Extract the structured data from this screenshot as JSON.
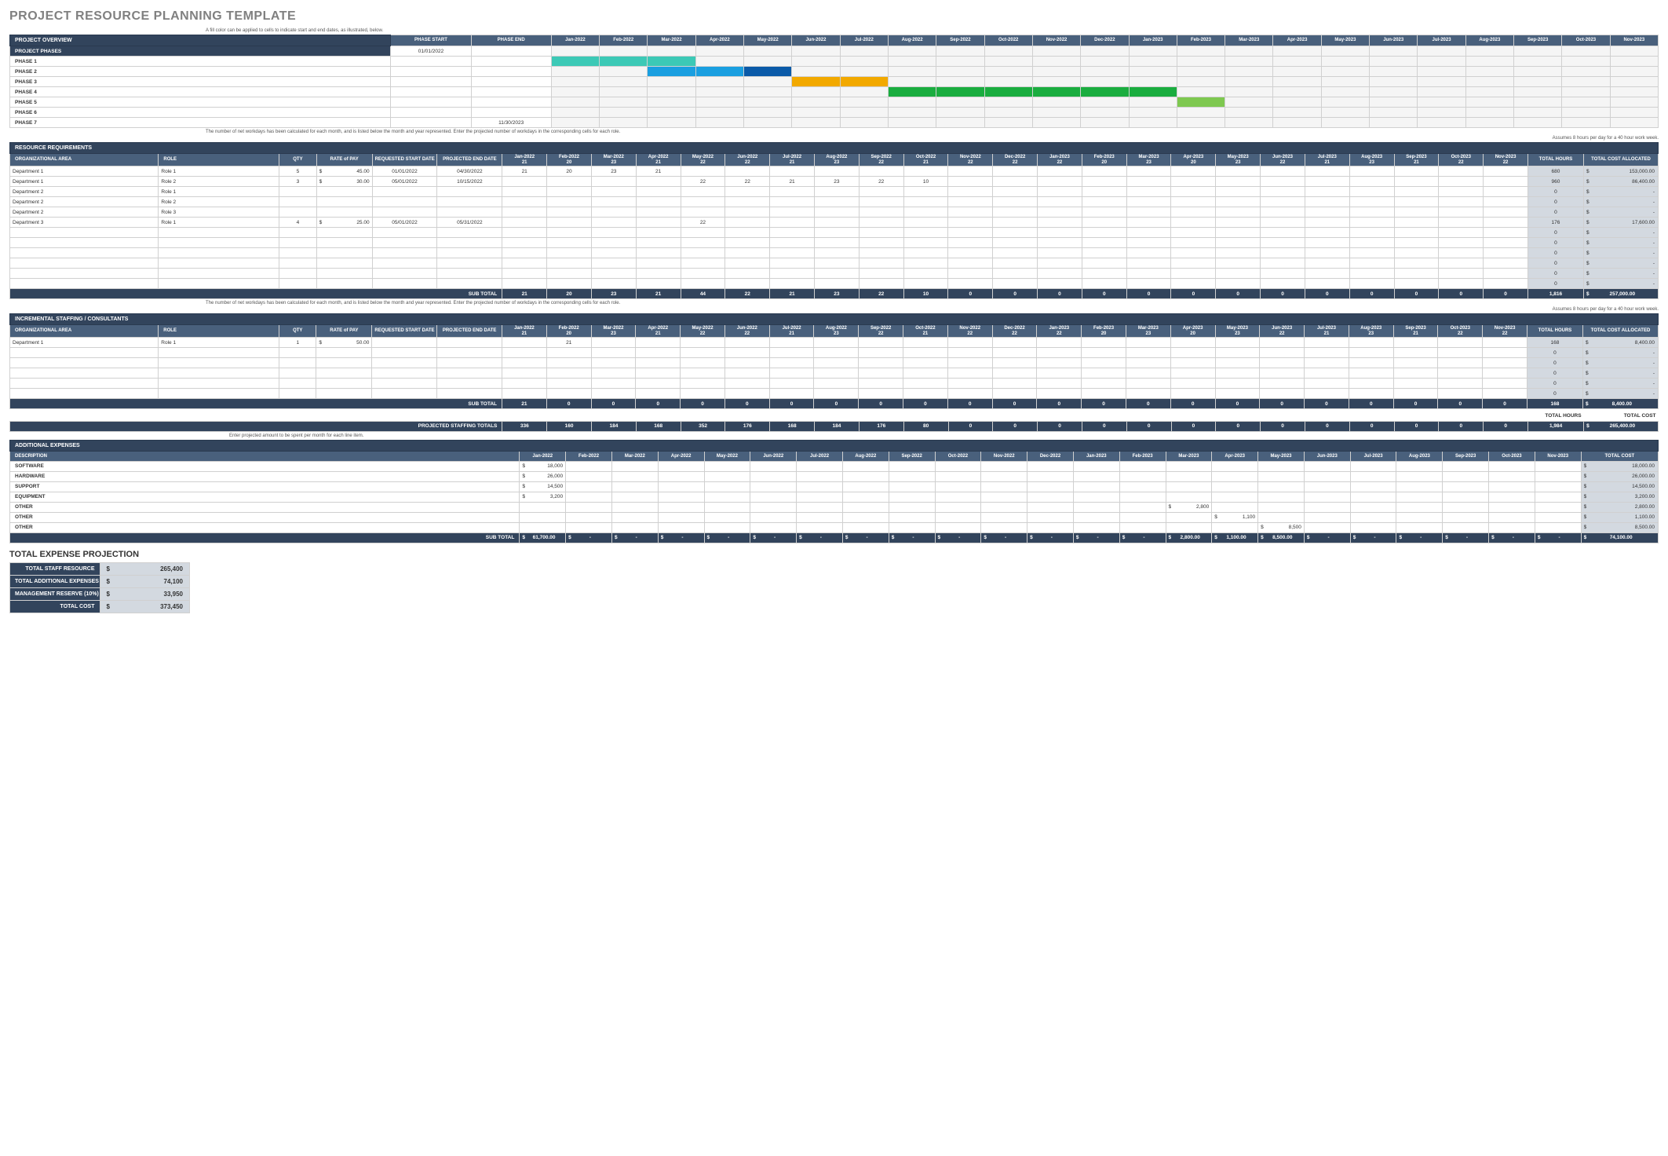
{
  "title": "PROJECT RESOURCE PLANNING TEMPLATE",
  "notes": {
    "gantt_hint": "A fill color can be applied to cells to indicate start and end dates, as illustrated, below.",
    "workdays_hint": "The number of net workdays has been calculated for each month, and is listed below the month and year represented. Enter the projected number of workdays in the corresponding cells for each role.",
    "hours_assumption": "Assumes 8 hours per day for a 40 hour work week.",
    "expense_hint": "Enter projected amount to be spent per month for each line item."
  },
  "months": [
    "Jan-2022",
    "Feb-2022",
    "Mar-2022",
    "Apr-2022",
    "May-2022",
    "Jun-2022",
    "Jul-2022",
    "Aug-2022",
    "Sep-2022",
    "Oct-2022",
    "Nov-2022",
    "Dec-2022",
    "Jan-2023",
    "Feb-2023",
    "Mar-2023",
    "Apr-2023",
    "May-2023",
    "Jun-2023",
    "Jul-2023",
    "Aug-2023",
    "Sep-2023",
    "Oct-2023",
    "Nov-2023"
  ],
  "workdays": [
    "21",
    "20",
    "23",
    "21",
    "22",
    "22",
    "21",
    "23",
    "22",
    "21",
    "22",
    "22",
    "22",
    "20",
    "23",
    "20",
    "23",
    "22",
    "21",
    "23",
    "21",
    "22",
    "22"
  ],
  "overview": {
    "section": "PROJECT OVERVIEW",
    "cols": [
      "PHASE START",
      "PHASE END"
    ],
    "rows": [
      {
        "label": "PROJECT PHASES",
        "start": "01/01/2022",
        "end": "",
        "highlight": true,
        "bars": []
      },
      {
        "label": "PHASE 1",
        "start": "",
        "end": "",
        "bars": [
          {
            "c": "g-teal",
            "s": 0,
            "e": 3
          }
        ]
      },
      {
        "label": "PHASE 2",
        "start": "",
        "end": "",
        "bars": [
          {
            "c": "g-blue",
            "s": 2,
            "e": 4
          },
          {
            "c": "g-dblue",
            "s": 4,
            "e": 5
          }
        ]
      },
      {
        "label": "PHASE 3",
        "start": "",
        "end": "",
        "bars": [
          {
            "c": "g-orange",
            "s": 5,
            "e": 7
          }
        ]
      },
      {
        "label": "PHASE 4",
        "start": "",
        "end": "",
        "bars": [
          {
            "c": "g-green",
            "s": 7,
            "e": 13
          }
        ]
      },
      {
        "label": "PHASE 5",
        "start": "",
        "end": "",
        "bars": [
          {
            "c": "g-lgreen",
            "s": 13,
            "e": 14
          }
        ]
      },
      {
        "label": "PHASE 6",
        "start": "",
        "end": "",
        "bars": []
      },
      {
        "label": "PHASE 7",
        "start": "",
        "end": "11/30/2023",
        "bars": []
      }
    ]
  },
  "resources": {
    "section": "RESOURCE REQUIREMENTS",
    "headers": [
      "ORGANIZATIONAL AREA",
      "ROLE",
      "QTY",
      "RATE of PAY",
      "REQUESTED START DATE",
      "PROJECTED END DATE"
    ],
    "totals_headers": [
      "TOTAL HOURS",
      "TOTAL COST ALLOCATED"
    ],
    "rows": [
      {
        "area": "Department 1",
        "role": "Role 1",
        "qty": "5",
        "rate": "45.00",
        "start": "01/01/2022",
        "end": "04/30/2022",
        "months": [
          "21",
          "20",
          "23",
          "21",
          "",
          "",
          "",
          "",
          "",
          "",
          "",
          "",
          "",
          "",
          "",
          "",
          "",
          "",
          "",
          "",
          "",
          "",
          ""
        ],
        "hours": "680",
        "cost": "153,000.00"
      },
      {
        "area": "Department 1",
        "role": "Role 2",
        "qty": "3",
        "rate": "30.00",
        "start": "05/01/2022",
        "end": "10/15/2022",
        "months": [
          "",
          "",
          "",
          "",
          "22",
          "22",
          "21",
          "23",
          "22",
          "10",
          "",
          "",
          "",
          "",
          "",
          "",
          "",
          "",
          "",
          "",
          "",
          "",
          ""
        ],
        "hours": "960",
        "cost": "86,400.00"
      },
      {
        "area": "Department 2",
        "role": "Role 1",
        "qty": "",
        "rate": "",
        "start": "",
        "end": "",
        "months": [
          "",
          "",
          "",
          "",
          "",
          "",
          "",
          "",
          "",
          "",
          "",
          "",
          "",
          "",
          "",
          "",
          "",
          "",
          "",
          "",
          "",
          "",
          ""
        ],
        "hours": "0",
        "cost": "-"
      },
      {
        "area": "Department 2",
        "role": "Role 2",
        "qty": "",
        "rate": "",
        "start": "",
        "end": "",
        "months": [
          "",
          "",
          "",
          "",
          "",
          "",
          "",
          "",
          "",
          "",
          "",
          "",
          "",
          "",
          "",
          "",
          "",
          "",
          "",
          "",
          "",
          "",
          ""
        ],
        "hours": "0",
        "cost": "-"
      },
      {
        "area": "Department 2",
        "role": "Role 3",
        "qty": "",
        "rate": "",
        "start": "",
        "end": "",
        "months": [
          "",
          "",
          "",
          "",
          "",
          "",
          "",
          "",
          "",
          "",
          "",
          "",
          "",
          "",
          "",
          "",
          "",
          "",
          "",
          "",
          "",
          "",
          ""
        ],
        "hours": "0",
        "cost": "-"
      },
      {
        "area": "Department 3",
        "role": "Role 1",
        "qty": "4",
        "rate": "25.00",
        "start": "05/01/2022",
        "end": "05/31/2022",
        "months": [
          "",
          "",
          "",
          "",
          "22",
          "",
          "",
          "",
          "",
          "",
          "",
          "",
          "",
          "",
          "",
          "",
          "",
          "",
          "",
          "",
          "",
          "",
          ""
        ],
        "hours": "176",
        "cost": "17,600.00"
      },
      {
        "area": "",
        "role": "",
        "qty": "",
        "rate": "",
        "start": "",
        "end": "",
        "months": [
          "",
          "",
          "",
          "",
          "",
          "",
          "",
          "",
          "",
          "",
          "",
          "",
          "",
          "",
          "",
          "",
          "",
          "",
          "",
          "",
          "",
          "",
          ""
        ],
        "hours": "0",
        "cost": "-"
      },
      {
        "area": "",
        "role": "",
        "qty": "",
        "rate": "",
        "start": "",
        "end": "",
        "months": [
          "",
          "",
          "",
          "",
          "",
          "",
          "",
          "",
          "",
          "",
          "",
          "",
          "",
          "",
          "",
          "",
          "",
          "",
          "",
          "",
          "",
          "",
          ""
        ],
        "hours": "0",
        "cost": "-"
      },
      {
        "area": "",
        "role": "",
        "qty": "",
        "rate": "",
        "start": "",
        "end": "",
        "months": [
          "",
          "",
          "",
          "",
          "",
          "",
          "",
          "",
          "",
          "",
          "",
          "",
          "",
          "",
          "",
          "",
          "",
          "",
          "",
          "",
          "",
          "",
          ""
        ],
        "hours": "0",
        "cost": "-"
      },
      {
        "area": "",
        "role": "",
        "qty": "",
        "rate": "",
        "start": "",
        "end": "",
        "months": [
          "",
          "",
          "",
          "",
          "",
          "",
          "",
          "",
          "",
          "",
          "",
          "",
          "",
          "",
          "",
          "",
          "",
          "",
          "",
          "",
          "",
          "",
          ""
        ],
        "hours": "0",
        "cost": "-"
      },
      {
        "area": "",
        "role": "",
        "qty": "",
        "rate": "",
        "start": "",
        "end": "",
        "months": [
          "",
          "",
          "",
          "",
          "",
          "",
          "",
          "",
          "",
          "",
          "",
          "",
          "",
          "",
          "",
          "",
          "",
          "",
          "",
          "",
          "",
          "",
          ""
        ],
        "hours": "0",
        "cost": "-"
      },
      {
        "area": "",
        "role": "",
        "qty": "",
        "rate": "",
        "start": "",
        "end": "",
        "months": [
          "",
          "",
          "",
          "",
          "",
          "",
          "",
          "",
          "",
          "",
          "",
          "",
          "",
          "",
          "",
          "",
          "",
          "",
          "",
          "",
          "",
          "",
          ""
        ],
        "hours": "0",
        "cost": "-"
      }
    ],
    "subtotal": {
      "label": "SUB TOTAL",
      "months": [
        "21",
        "20",
        "23",
        "21",
        "44",
        "22",
        "21",
        "23",
        "22",
        "10",
        "0",
        "0",
        "0",
        "0",
        "0",
        "0",
        "0",
        "0",
        "0",
        "0",
        "0",
        "0",
        "0"
      ],
      "hours": "1,816",
      "cost": "257,000.00"
    }
  },
  "consultants": {
    "section": "INCREMENTAL STAFFING / CONSULTANTS",
    "rows": [
      {
        "area": "Department 1",
        "role": "Role 1",
        "qty": "1",
        "rate": "50.00",
        "start": "",
        "end": "",
        "months": [
          "",
          "21",
          "",
          "",
          "",
          "",
          "",
          "",
          "",
          "",
          "",
          "",
          "",
          "",
          "",
          "",
          "",
          "",
          "",
          "",
          "",
          "",
          ""
        ],
        "hours": "168",
        "cost": "8,400.00"
      },
      {
        "area": "",
        "role": "",
        "qty": "",
        "rate": "",
        "start": "",
        "end": "",
        "months": [
          "",
          "",
          "",
          "",
          "",
          "",
          "",
          "",
          "",
          "",
          "",
          "",
          "",
          "",
          "",
          "",
          "",
          "",
          "",
          "",
          "",
          "",
          ""
        ],
        "hours": "0",
        "cost": "-"
      },
      {
        "area": "",
        "role": "",
        "qty": "",
        "rate": "",
        "start": "",
        "end": "",
        "months": [
          "",
          "",
          "",
          "",
          "",
          "",
          "",
          "",
          "",
          "",
          "",
          "",
          "",
          "",
          "",
          "",
          "",
          "",
          "",
          "",
          "",
          "",
          ""
        ],
        "hours": "0",
        "cost": "-"
      },
      {
        "area": "",
        "role": "",
        "qty": "",
        "rate": "",
        "start": "",
        "end": "",
        "months": [
          "",
          "",
          "",
          "",
          "",
          "",
          "",
          "",
          "",
          "",
          "",
          "",
          "",
          "",
          "",
          "",
          "",
          "",
          "",
          "",
          "",
          "",
          ""
        ],
        "hours": "0",
        "cost": "-"
      },
      {
        "area": "",
        "role": "",
        "qty": "",
        "rate": "",
        "start": "",
        "end": "",
        "months": [
          "",
          "",
          "",
          "",
          "",
          "",
          "",
          "",
          "",
          "",
          "",
          "",
          "",
          "",
          "",
          "",
          "",
          "",
          "",
          "",
          "",
          "",
          ""
        ],
        "hours": "0",
        "cost": "-"
      },
      {
        "area": "",
        "role": "",
        "qty": "",
        "rate": "",
        "start": "",
        "end": "",
        "months": [
          "",
          "",
          "",
          "",
          "",
          "",
          "",
          "",
          "",
          "",
          "",
          "",
          "",
          "",
          "",
          "",
          "",
          "",
          "",
          "",
          "",
          "",
          ""
        ],
        "hours": "0",
        "cost": "-"
      }
    ],
    "subtotal": {
      "label": "SUB TOTAL",
      "months": [
        "21",
        "0",
        "0",
        "0",
        "0",
        "0",
        "0",
        "0",
        "0",
        "0",
        "0",
        "0",
        "0",
        "0",
        "0",
        "0",
        "0",
        "0",
        "0",
        "0",
        "0",
        "0",
        "0"
      ],
      "hours": "168",
      "cost": "8,400.00"
    }
  },
  "staffing_totals": {
    "labels": [
      "TOTAL HOURS",
      "TOTAL COST"
    ],
    "label": "PROJECTED STAFFING TOTALS",
    "months": [
      "336",
      "160",
      "184",
      "168",
      "352",
      "176",
      "168",
      "184",
      "176",
      "80",
      "0",
      "0",
      "0",
      "0",
      "0",
      "0",
      "0",
      "0",
      "0",
      "0",
      "0",
      "0",
      "0"
    ],
    "hours": "1,984",
    "cost": "265,400.00"
  },
  "expenses": {
    "section": "ADDITIONAL EXPENSES",
    "desc_hdr": "DESCRIPTION",
    "total_hdr": "TOTAL COST",
    "rows": [
      {
        "desc": "SOFTWARE",
        "months": [
          "18,000",
          "",
          "",
          "",
          "",
          "",
          "",
          "",
          "",
          "",
          "",
          "",
          "",
          "",
          "",
          "",
          "",
          "",
          "",
          "",
          "",
          "",
          ""
        ],
        "total": "18,000.00"
      },
      {
        "desc": "HARDWARE",
        "months": [
          "26,000",
          "",
          "",
          "",
          "",
          "",
          "",
          "",
          "",
          "",
          "",
          "",
          "",
          "",
          "",
          "",
          "",
          "",
          "",
          "",
          "",
          "",
          ""
        ],
        "total": "26,000.00"
      },
      {
        "desc": "SUPPORT",
        "months": [
          "14,500",
          "",
          "",
          "",
          "",
          "",
          "",
          "",
          "",
          "",
          "",
          "",
          "",
          "",
          "",
          "",
          "",
          "",
          "",
          "",
          "",
          "",
          ""
        ],
        "total": "14,500.00"
      },
      {
        "desc": "EQUIPMENT",
        "months": [
          "3,200",
          "",
          "",
          "",
          "",
          "",
          "",
          "",
          "",
          "",
          "",
          "",
          "",
          "",
          "",
          "",
          "",
          "",
          "",
          "",
          "",
          "",
          ""
        ],
        "total": "3,200.00"
      },
      {
        "desc": "OTHER",
        "months": [
          "",
          "",
          "",
          "",
          "",
          "",
          "",
          "",
          "",
          "",
          "",
          "",
          "",
          "",
          "2,800",
          "",
          "",
          "",
          "",
          "",
          "",
          "",
          ""
        ],
        "total": "2,800.00"
      },
      {
        "desc": "OTHER",
        "months": [
          "",
          "",
          "",
          "",
          "",
          "",
          "",
          "",
          "",
          "",
          "",
          "",
          "",
          "",
          "",
          "1,100",
          "",
          "",
          "",
          "",
          "",
          "",
          ""
        ],
        "total": "1,100.00"
      },
      {
        "desc": "OTHER",
        "months": [
          "",
          "",
          "",
          "",
          "",
          "",
          "",
          "",
          "",
          "",
          "",
          "",
          "",
          "",
          "",
          "",
          "8,500",
          "",
          "",
          "",
          "",
          "",
          ""
        ],
        "total": "8,500.00"
      }
    ],
    "subtotal": {
      "label": "SUB TOTAL",
      "months": [
        "61,700.00",
        "-",
        "-",
        "-",
        "-",
        "-",
        "-",
        "-",
        "-",
        "-",
        "-",
        "-",
        "-",
        "-",
        "2,800.00",
        "1,100.00",
        "8,500.00",
        "-",
        "-",
        "-",
        "-",
        "-",
        "-"
      ],
      "total": "74,100.00"
    }
  },
  "projection": {
    "title": "TOTAL EXPENSE PROJECTION",
    "rows": [
      {
        "k": "TOTAL STAFF RESOURCE",
        "v": "265,400"
      },
      {
        "k": "TOTAL ADDITIONAL EXPENSES",
        "v": "74,100"
      },
      {
        "k": "MANAGEMENT RESERVE (10%)",
        "v": "33,950"
      },
      {
        "k": "TOTAL COST",
        "v": "373,450"
      }
    ]
  }
}
